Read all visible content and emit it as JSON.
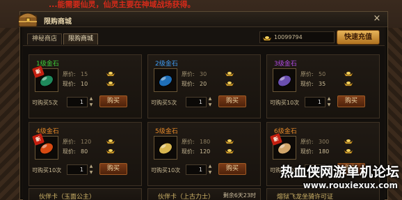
{
  "background": {
    "banner_text": "...能需要仙灵，仙灵主要在神域战场获得。"
  },
  "window": {
    "title": "限购商城",
    "close_glyph": "×"
  },
  "tabs": [
    {
      "label": "神秘商店",
      "active": false
    },
    {
      "label": "限购商城",
      "active": true
    }
  ],
  "currency": {
    "amount": "10099794",
    "icon": "gold-ingot-icon"
  },
  "recharge_label": "快速充值",
  "labels": {
    "original_price": "原价:",
    "current_price": "现价:",
    "buy_label": "购买"
  },
  "items": [
    {
      "name": "1级金石",
      "name_color": "#3fd13a",
      "gem_color": "#1f8a5c",
      "badge": "新",
      "original": "15",
      "current": "10",
      "limit": "可购买5次",
      "qty": "1"
    },
    {
      "name": "2级金石",
      "name_color": "#3f9df5",
      "gem_color": "#1f6fb8",
      "badge": "",
      "original": "30",
      "current": "20",
      "limit": "可购买5次",
      "qty": "1"
    },
    {
      "name": "3级金石",
      "name_color": "#b34be6",
      "gem_color": "#6a4fb0",
      "badge": "",
      "original": "50",
      "current": "35",
      "limit": "可购买10次",
      "qty": "1"
    },
    {
      "name": "4级金石",
      "name_color": "#e78a2a",
      "gem_color": "#d74a12",
      "badge": "新",
      "original": "120",
      "current": "80",
      "limit": "可购买10次",
      "qty": "1"
    },
    {
      "name": "5级金石",
      "name_color": "#e78a2a",
      "gem_color": "#d8b650",
      "badge": "",
      "original": "180",
      "current": "120",
      "limit": "可购买10次",
      "qty": "1"
    },
    {
      "name": "6级金石",
      "name_color": "#e78a2a",
      "gem_color": "#d0a56a",
      "badge": "新",
      "original": "300",
      "current": "180",
      "limit": "可购买10次",
      "qty": "1"
    }
  ],
  "bottom_items": [
    {
      "name": "伙伴卡（玉面公主）",
      "remain": ""
    },
    {
      "name": "伙伴卡（上古力士）",
      "remain": "剩余6天23时"
    },
    {
      "name": "熔狱飞龙坐骑许可证",
      "remain": ""
    }
  ],
  "watermark": {
    "title": "热血侠网游单机论坛",
    "url": "www.rouxiexux.com"
  }
}
